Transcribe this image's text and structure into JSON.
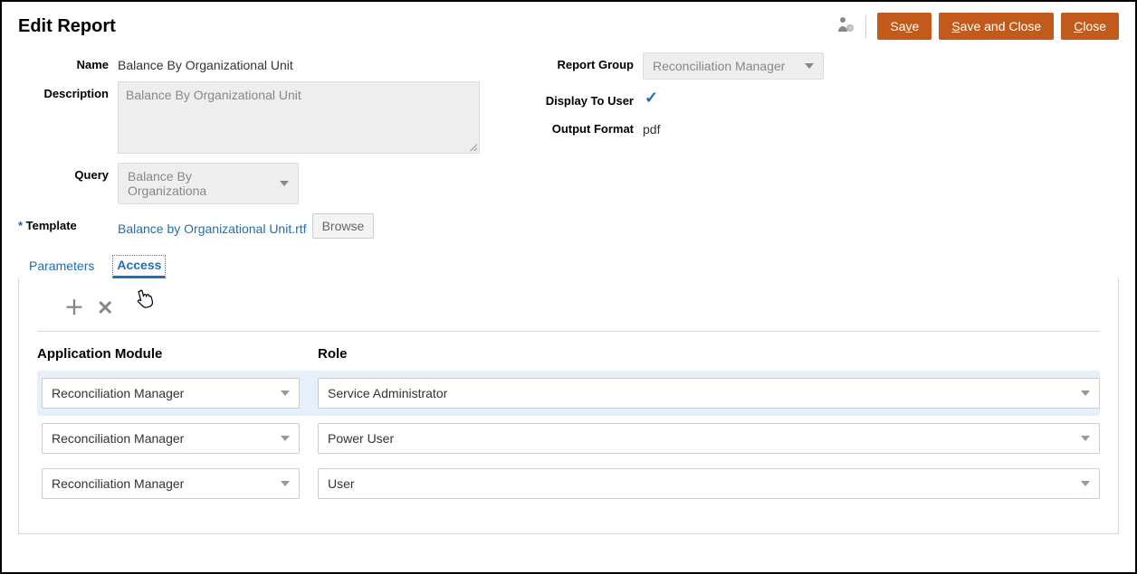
{
  "header": {
    "title": "Edit Report",
    "save_label": "Save",
    "save_close_label": "Save and Close",
    "close_label": "Close"
  },
  "form": {
    "name_label": "Name",
    "name_value": "Balance By Organizational Unit",
    "description_label": "Description",
    "description_placeholder": "Balance By Organizational Unit",
    "query_label": "Query",
    "query_value": "Balance By Organizationa",
    "template_label": "Template",
    "template_value": "Balance by Organizational Unit.rtf",
    "browse_label": "Browse",
    "report_group_label": "Report Group",
    "report_group_value": "Reconciliation Manager",
    "display_to_user_label": "Display To User",
    "display_to_user_checked": true,
    "output_format_label": "Output Format",
    "output_format_value": "pdf"
  },
  "tabs": {
    "parameters": "Parameters",
    "access": "Access",
    "active": "access"
  },
  "access_grid": {
    "col_module": "Application Module",
    "col_role": "Role",
    "rows": [
      {
        "module": "Reconciliation Manager",
        "role": "Service Administrator",
        "selected": true
      },
      {
        "module": "Reconciliation Manager",
        "role": "Power User",
        "selected": false
      },
      {
        "module": "Reconciliation Manager",
        "role": "User",
        "selected": false
      }
    ]
  }
}
